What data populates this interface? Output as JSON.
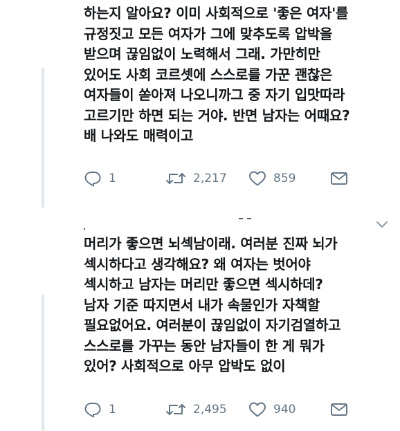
{
  "tweets": [
    {
      "text": "하는지 알아요? 이미 사회적으로 '좋은 여자'를\n규정짓고 모든 여자가 그에 맞추도록 압박을\n받으며 끊임없이 노력해서 그래. 가만히만\n있어도 사회 코르셋에 스스로를 가꾼 괜찮은\n여자들이 쏟아져 나오니까그 중 자기 입맛따라\n고르기만 하면 되는 거야. 반면 남자는 어때요?\n배 나와도 매력이고",
      "reply_count": "1",
      "retweet_count": "2,217",
      "like_count": "859",
      "icons": {
        "reply": "reply-icon",
        "retweet": "retweet-icon",
        "like": "heart-icon",
        "message": "envelope-icon"
      }
    },
    {
      "text": "머리가 좋으면 뇌섹남이래. 여러분 진짜 뇌가\n섹시하다고 생각해요? 왜 여자는 벗어야\n섹시하고 남자는 머리만 좋으면 섹시하데?\n남자 기준 따지면서 내가 속물인가 자책할\n필요없어요. 여러분이 끊임없이 자기검열하고\n스스로를 가꾸는 동안 남자들이 한 게 뭐가\n있어? 사회적으로 아무 압박도 없이",
      "reply_count": "1",
      "retweet_count": "2,495",
      "like_count": "940",
      "icons": {
        "reply": "reply-icon",
        "retweet": "retweet-icon",
        "like": "heart-icon",
        "message": "envelope-icon"
      }
    }
  ],
  "colors": {
    "text": "#14171a",
    "icon": "#657786",
    "thread_line": "#e1e8ed"
  },
  "menu_icon": "chevron-down-icon"
}
